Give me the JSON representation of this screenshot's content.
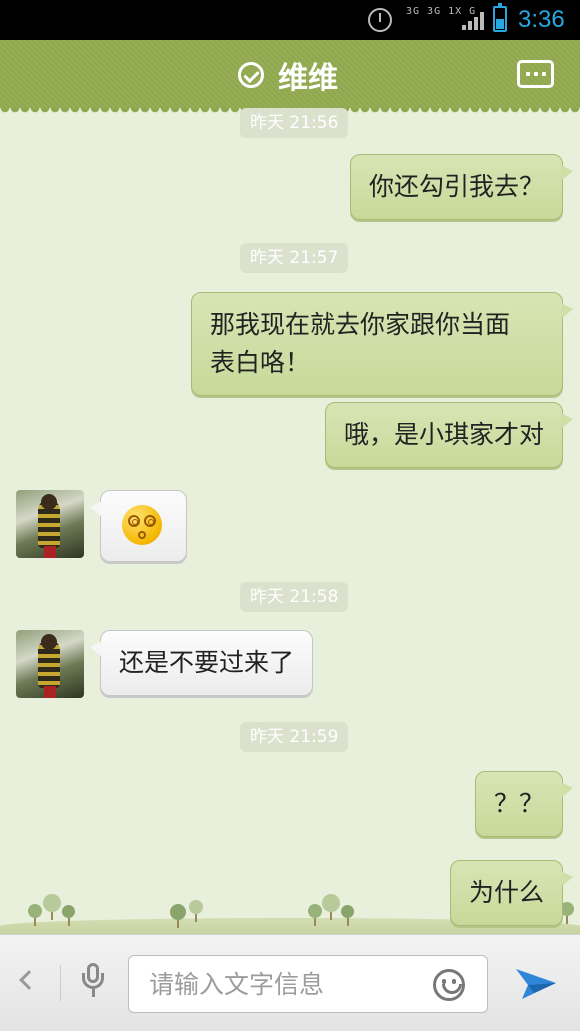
{
  "statusbar": {
    "network_label": "3G 3G 1X G",
    "time": "3:36"
  },
  "header": {
    "title": "维维"
  },
  "chat": {
    "timestamps": [
      "昨天 21:56",
      "昨天 21:57",
      "昨天 21:58",
      "昨天 21:59"
    ],
    "messages": [
      {
        "from": "me",
        "text": "你还勾引我去？"
      },
      {
        "from": "me",
        "line1": "那我现在就去你家跟你当面",
        "line2": "表白咯！"
      },
      {
        "from": "me",
        "text": "哦，是小琪家才对"
      },
      {
        "from": "them",
        "emoji": "dizzy-face-emoji"
      },
      {
        "from": "them",
        "text": "还是不要过来了"
      },
      {
        "from": "me",
        "text": "？？"
      },
      {
        "from": "me",
        "text": "为什么"
      }
    ]
  },
  "input": {
    "placeholder": "请输入文字信息"
  },
  "colors": {
    "header": "#8fa74e",
    "my_bubble": "#cfdfa8",
    "their_bubble": "#f6f6f6",
    "chat_bg": "#e8efda",
    "clock": "#28a8e0"
  }
}
